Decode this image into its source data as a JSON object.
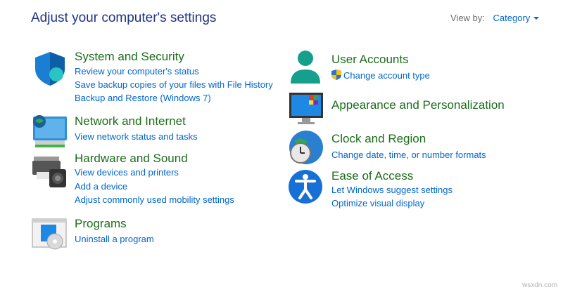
{
  "header": {
    "title": "Adjust your computer's settings",
    "view_by_label": "View by:",
    "view_by_value": "Category"
  },
  "categories": [
    {
      "title": "System and Security",
      "icon": "shield-icon",
      "links": [
        "Review your computer's status",
        "Save backup copies of your files with File History",
        "Backup and Restore (Windows 7)"
      ]
    },
    {
      "title": "Network and Internet",
      "icon": "network-globe-icon",
      "links": [
        "View network status and tasks"
      ]
    },
    {
      "title": "Hardware and Sound",
      "icon": "printer-speaker-icon",
      "links": [
        "View devices and printers",
        "Add a device",
        "Adjust commonly used mobility settings"
      ]
    },
    {
      "title": "Programs",
      "icon": "programs-icon",
      "links": [
        "Uninstall a program"
      ]
    },
    {
      "title": "User Accounts",
      "icon": "user-icon",
      "links": [
        "Change account type"
      ]
    },
    {
      "title": "Appearance and Personalization",
      "icon": "monitor-icon",
      "links": []
    },
    {
      "title": "Clock and Region",
      "icon": "clock-globe-icon",
      "links": [
        "Change date, time, or number formats"
      ]
    },
    {
      "title": "Ease of Access",
      "icon": "ease-of-access-icon",
      "links": [
        "Let Windows suggest settings",
        "Optimize visual display"
      ]
    }
  ],
  "watermark": "wsxdn.com",
  "colors": {
    "title_blue": "#1e3287",
    "category_green": "#1b6d1b",
    "link_blue": "#0066cc"
  }
}
